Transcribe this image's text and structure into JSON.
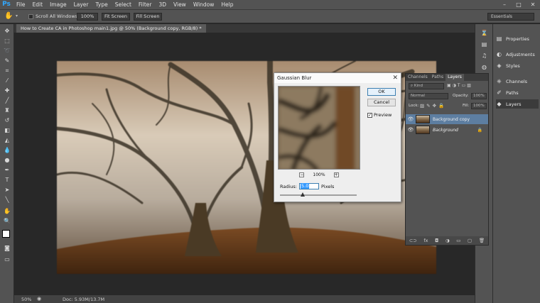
{
  "app": {
    "logo": "Ps"
  },
  "menu": [
    "File",
    "Edit",
    "Image",
    "Layer",
    "Type",
    "Select",
    "Filter",
    "3D",
    "View",
    "Window",
    "Help"
  ],
  "window_controls": [
    "–",
    "□",
    "✕"
  ],
  "options": {
    "scroll_all_label": "Scroll All Windows",
    "btn_zoom": "100%",
    "btn_fit": "Fit Screen",
    "btn_fill": "Fill Screen",
    "workspace": "Essentials"
  },
  "document": {
    "tab_title": "How to Create CA in Photoshop main1.jpg @ 50% (Background copy, RGB/8) *",
    "zoom": "50%",
    "doc_size": "Doc: 5.93M/13.7M"
  },
  "panels": {
    "items": [
      "Properties",
      "Adjustments",
      "Styles",
      "Channels",
      "Paths",
      "Layers"
    ],
    "icons": [
      "properties-icon",
      "adjustments-icon",
      "styles-icon",
      "channels-icon",
      "paths-icon",
      "layers-icon"
    ]
  },
  "layers_panel": {
    "tabs": [
      "Channels",
      "Paths",
      "Layers"
    ],
    "kind": "Kind",
    "blend_mode": "Normal",
    "opacity_label": "Opacity:",
    "opacity_value": "100%",
    "lock_label": "Lock:",
    "fill_label": "Fill:",
    "fill_value": "100%",
    "layers": [
      "Background copy",
      "Background"
    ],
    "bottom_icons": [
      "⊂⊃",
      "fx",
      "◘",
      "◑",
      "▭",
      "▢",
      "🗑"
    ]
  },
  "gaussian_blur": {
    "title": "Gaussian Blur",
    "ok": "OK",
    "cancel": "Cancel",
    "preview_label": "Preview",
    "preview_checked": true,
    "zoom_value": "100%",
    "zoom_out": "−",
    "zoom_in": "+",
    "radius_label": "Radius:",
    "radius_value": "5.0",
    "radius_unit": "Pixels",
    "slider_level": 0.3
  }
}
